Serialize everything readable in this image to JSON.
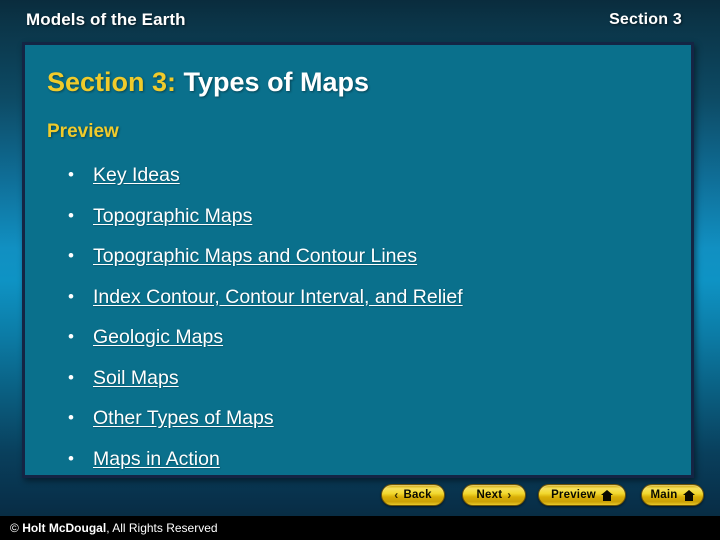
{
  "header": {
    "course_title": "Models of the Earth",
    "section_label": "Section 3"
  },
  "slide": {
    "title_prefix": "Section 3:",
    "title_main": " Types of Maps",
    "preview_heading": "Preview",
    "bullet_glyph": "•",
    "links": [
      {
        "label": "Key Ideas"
      },
      {
        "label": "Topographic Maps"
      },
      {
        "label": "Topographic Maps and Contour Lines"
      },
      {
        "label": "Index Contour, Contour Interval, and Relief"
      },
      {
        "label": "Geologic Maps"
      },
      {
        "label": "Soil Maps"
      },
      {
        "label": "Other Types of Maps"
      },
      {
        "label": "Maps in Action"
      }
    ]
  },
  "nav": {
    "back_label": "Back",
    "back_chevron": "‹",
    "next_label": "Next",
    "next_chevron": "›",
    "preview_label": "Preview",
    "main_label": "Main"
  },
  "footer": {
    "copyright_symbol": "©",
    "brand": "Holt McDougal",
    "rights": ", All Rights Reserved"
  },
  "colors": {
    "gold_text": "#f0cb2b",
    "box_fill": "#0a708c",
    "box_border": "#142544",
    "button_gold": "#f2d92f",
    "background_mid": "#0e93c4",
    "background_dark": "#0b3447"
  }
}
